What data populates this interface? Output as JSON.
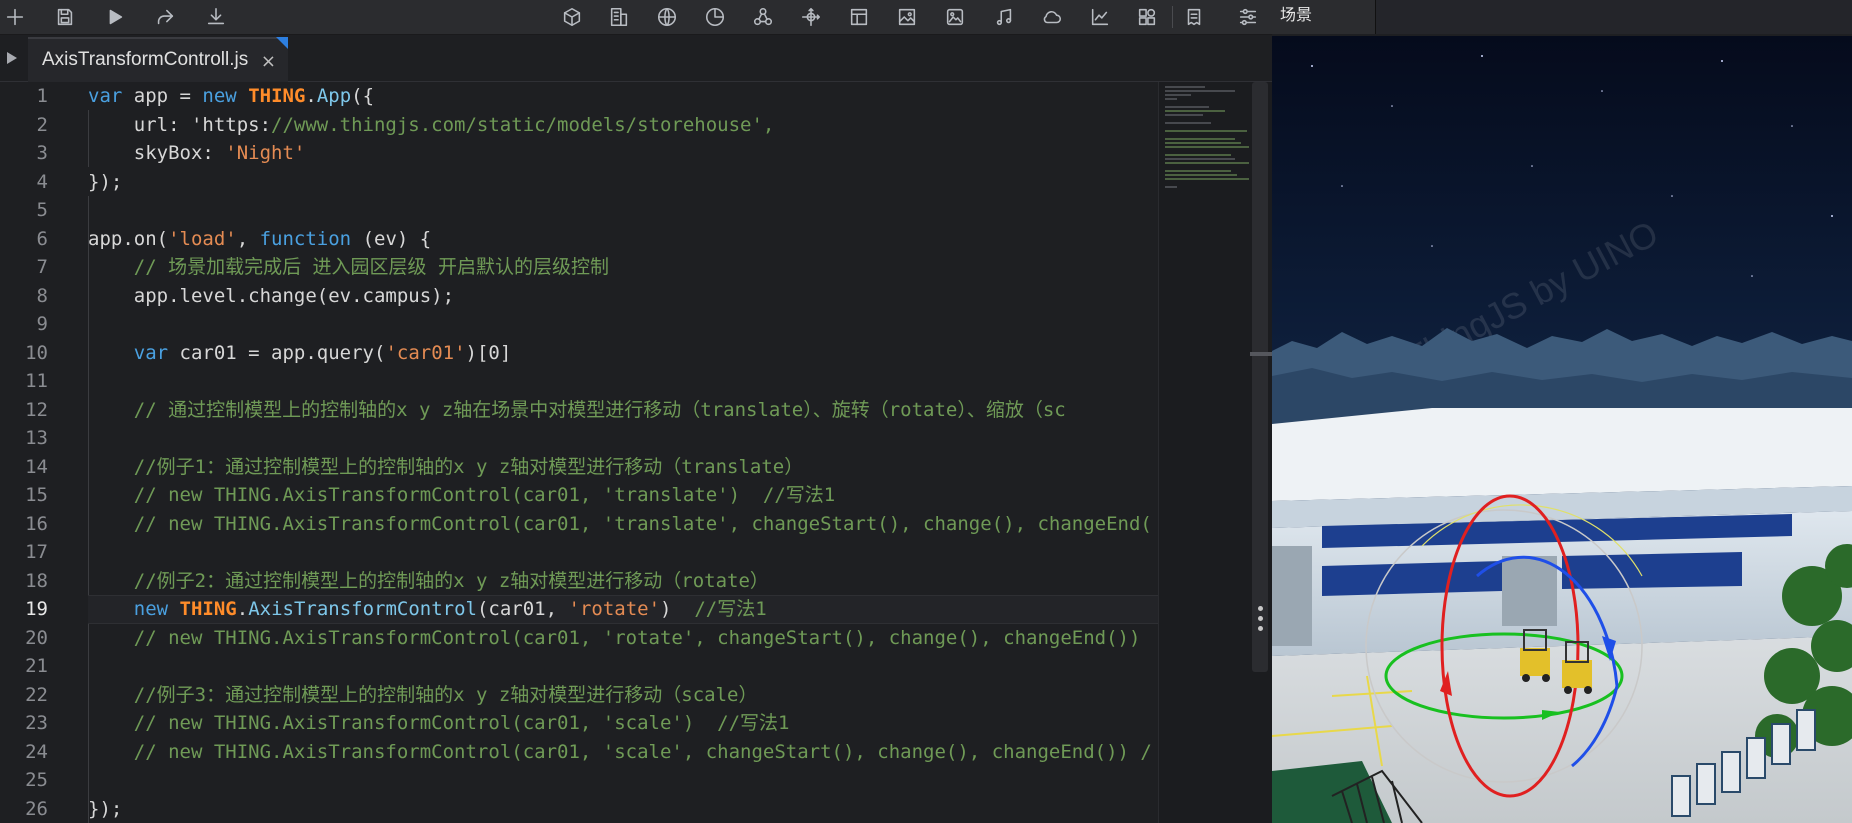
{
  "toolbar": {
    "buttons": [
      {
        "name": "new-file-icon"
      },
      {
        "name": "save-icon"
      },
      {
        "name": "run-icon"
      },
      {
        "name": "share-icon"
      },
      {
        "name": "download-icon"
      },
      {
        "name": "cube-icon"
      },
      {
        "name": "building-icon"
      },
      {
        "name": "globe-icon"
      },
      {
        "name": "pie-chart-icon"
      },
      {
        "name": "molecule-icon"
      },
      {
        "name": "transform-icon"
      },
      {
        "name": "layout-icon"
      },
      {
        "name": "image-icon"
      },
      {
        "name": "picture-icon"
      },
      {
        "name": "music-icon"
      },
      {
        "name": "cloud-icon"
      },
      {
        "name": "line-chart-icon"
      },
      {
        "name": "widgets-icon"
      },
      {
        "name": "notes-icon"
      },
      {
        "name": "settings-sliders-icon"
      }
    ]
  },
  "scene_tab": {
    "label": "场景"
  },
  "editor_tab": {
    "filename": "AxisTransformControll.js",
    "close": "×"
  },
  "editor": {
    "active_line": 19,
    "lines": [
      {
        "n": "1",
        "code": "var app = new THING.App({"
      },
      {
        "n": "2",
        "code": "    url: 'https://www.thingjs.com/static/models/storehouse',"
      },
      {
        "n": "3",
        "code": "    skyBox: 'Night'"
      },
      {
        "n": "4",
        "code": "});"
      },
      {
        "n": "5",
        "code": ""
      },
      {
        "n": "6",
        "code": "app.on('load', function (ev) {"
      },
      {
        "n": "7",
        "code": "    // 场景加载完成后 进入园区层级 开启默认的层级控制"
      },
      {
        "n": "8",
        "code": "    app.level.change(ev.campus);"
      },
      {
        "n": "9",
        "code": ""
      },
      {
        "n": "10",
        "code": "    var car01 = app.query('car01')[0]"
      },
      {
        "n": "11",
        "code": ""
      },
      {
        "n": "12",
        "code": "    // 通过控制模型上的控制轴的x y z轴在场景中对模型进行移动（translate）、旋转（rotate）、缩放（sc"
      },
      {
        "n": "13",
        "code": ""
      },
      {
        "n": "14",
        "code": "    //例子1：通过控制模型上的控制轴的x y z轴对模型进行移动（translate）"
      },
      {
        "n": "15",
        "code": "    // new THING.AxisTransformControl(car01, 'translate')  //写法1"
      },
      {
        "n": "16",
        "code": "    // new THING.AxisTransformControl(car01, 'translate', changeStart(), change(), changeEnd("
      },
      {
        "n": "17",
        "code": ""
      },
      {
        "n": "18",
        "code": "    //例子2：通过控制模型上的控制轴的x y z轴对模型进行移动（rotate）"
      },
      {
        "n": "19",
        "code": "    new THING.AxisTransformControl(car01, 'rotate')  //写法1"
      },
      {
        "n": "20",
        "code": "    // new THING.AxisTransformControl(car01, 'rotate', changeStart(), change(), changeEnd())"
      },
      {
        "n": "21",
        "code": ""
      },
      {
        "n": "22",
        "code": "    //例子3：通过控制模型上的控制轴的x y z轴对模型进行移动（scale）"
      },
      {
        "n": "23",
        "code": "    // new THING.AxisTransformControl(car01, 'scale')  //写法1"
      },
      {
        "n": "24",
        "code": "    // new THING.AxisTransformControl(car01, 'scale', changeStart(), change(), changeEnd()) /"
      },
      {
        "n": "25",
        "code": ""
      },
      {
        "n": "26",
        "code": "});"
      }
    ]
  },
  "scene": {
    "watermark": "ThingJS by UINO",
    "colors": {
      "sky_top": "#050b1c",
      "sky_bottom": "#1b3458",
      "axis_x": "#e02020",
      "axis_y": "#18c020",
      "axis_z": "#1f4fe8"
    }
  }
}
